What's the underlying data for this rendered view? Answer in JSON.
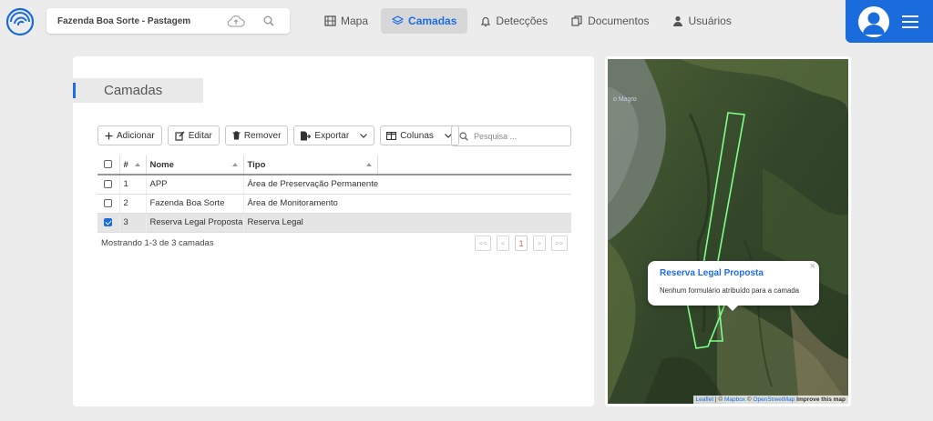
{
  "header": {
    "farm_name": "Fazenda Boa Sorte - Pastagem",
    "nav": [
      {
        "label": "Mapa",
        "icon": "map-icon",
        "active": false
      },
      {
        "label": "Camadas",
        "icon": "layers-icon",
        "active": true
      },
      {
        "label": "Detecções",
        "icon": "bell-icon",
        "active": false
      },
      {
        "label": "Documentos",
        "icon": "documents-icon",
        "active": false
      },
      {
        "label": "Usuários",
        "icon": "user-icon",
        "active": false
      }
    ],
    "accent_color": "#1a6bdb"
  },
  "panel": {
    "title": "Camadas",
    "toolbar": {
      "add": "Adicionar",
      "edit": "Editar",
      "remove": "Remover",
      "export": "Exportar",
      "columns": "Colunas"
    },
    "search_placeholder": "Pesquisa ...",
    "columns": {
      "num": "#",
      "name": "Nome",
      "type": "Tipo"
    },
    "rows": [
      {
        "num": "1",
        "name": "APP",
        "type": "Área de Preservação Permanente",
        "checked": false
      },
      {
        "num": "2",
        "name": "Fazenda Boa Sorte",
        "type": "Área de Monitoramento",
        "checked": false
      },
      {
        "num": "3",
        "name": "Reserva Legal Proposta",
        "type": "Reserva Legal",
        "checked": true
      }
    ],
    "summary": "Mostrando 1-3 de 3 camadas",
    "pager": {
      "first": "<<",
      "prev": "<",
      "current": "1",
      "next": ">",
      "last": ">>"
    }
  },
  "map": {
    "place_label": "o Magro",
    "popup": {
      "title": "Reserva Legal Proposta",
      "body": "Nenhum formulário atribuído para a camada",
      "close": "×"
    },
    "attribution": {
      "leaflet": "Leaflet",
      "sep1": " | © ",
      "mapbox": "Mapbox",
      "sep2": " © ",
      "osm": "OpenStreetMap",
      "improve": "Improve this map"
    },
    "polygon_color": "#7dff8a"
  }
}
